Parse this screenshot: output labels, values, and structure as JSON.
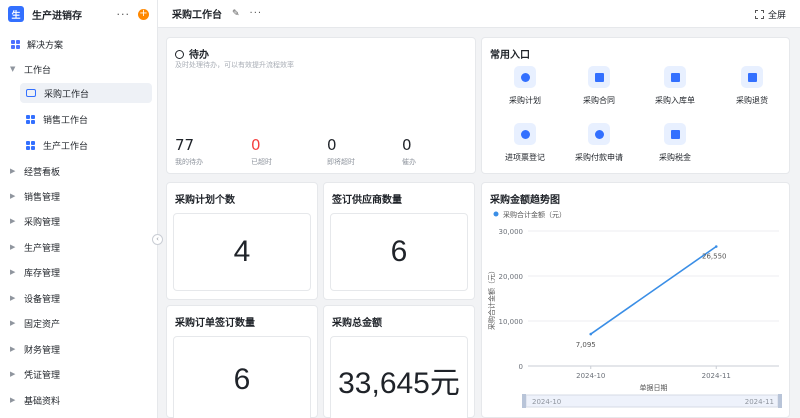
{
  "sidebar": {
    "logo": "生",
    "app_title": "生产进销存",
    "more": "···",
    "add": "+",
    "solution": "解决方案",
    "workbench": "工作台",
    "workbench_items": [
      "采购工作台",
      "销售工作台",
      "生产工作台"
    ],
    "sections": [
      "经营看板",
      "销售管理",
      "采购管理",
      "生产管理",
      "库存管理",
      "设备管理",
      "固定资产",
      "财务管理",
      "凭证管理",
      "基础资料"
    ]
  },
  "topbar": {
    "title": "采购工作台",
    "more": "···",
    "fullscreen": "全屏"
  },
  "todo": {
    "title": "待办",
    "subtitle": "及时处理待办，可以有效提升流程效率",
    "stats": [
      {
        "value": "77",
        "label": "我的待办"
      },
      {
        "value": "0",
        "label": "已超时"
      },
      {
        "value": "0",
        "label": "即将超时"
      },
      {
        "value": "0",
        "label": "催办"
      }
    ]
  },
  "entries": {
    "title": "常用入口",
    "items": [
      "采购计划",
      "采购合同",
      "采购入库单",
      "采购退货",
      "进项票登记",
      "采购付款申请",
      "采购税金"
    ]
  },
  "kpis": {
    "plan_count": {
      "title": "采购计划个数",
      "value": "4"
    },
    "supplier_count": {
      "title": "签订供应商数量",
      "value": "6"
    },
    "order_count": {
      "title": "采购订单签订数量",
      "value": "6"
    },
    "total_amount": {
      "title": "采购总金额",
      "value": "33,645元"
    }
  },
  "chart_data": {
    "type": "line",
    "title": "采购金额趋势图",
    "x": [
      "2024-10",
      "2024-11"
    ],
    "series": [
      {
        "name": "采购合计金额（元）",
        "values": [
          7095,
          26550
        ],
        "color": "#3a8ee6"
      }
    ],
    "data_labels": [
      "7,095",
      "26,550"
    ],
    "xlabel": "单据日期",
    "ylabel": "采购合计金额（元）",
    "ylim": [
      0,
      30000
    ],
    "yticks": [
      "0",
      "10,000",
      "20,000",
      "30,000"
    ],
    "legend": "top-left",
    "grid": true,
    "slider_labels": [
      "2024-10",
      "2024-11"
    ]
  }
}
